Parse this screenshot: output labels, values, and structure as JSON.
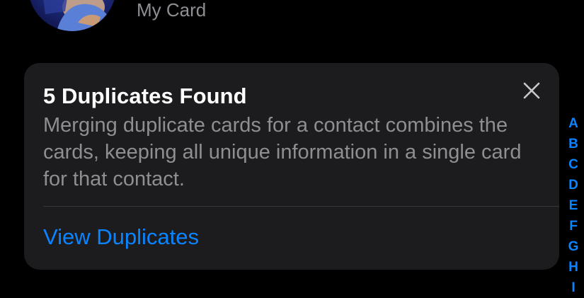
{
  "header": {
    "my_card_label": "My Card"
  },
  "banner": {
    "title": "5 Duplicates Found",
    "body": "Merging duplicate cards for a contact combines the cards, keeping all unique information in a single card for that contact.",
    "action_label": "View Duplicates",
    "close_icon": "close-icon"
  },
  "index_bar": {
    "letters": [
      "A",
      "B",
      "C",
      "D",
      "E",
      "F",
      "G",
      "H",
      "I"
    ]
  },
  "colors": {
    "background": "#000000",
    "card_background": "#1c1c1e",
    "accent": "#0a84ff",
    "secondary_text": "#8e8e93",
    "divider": "#38383a"
  }
}
